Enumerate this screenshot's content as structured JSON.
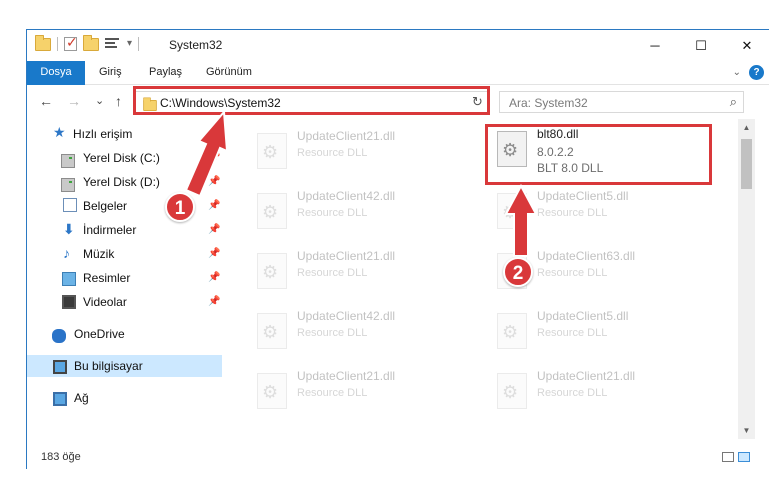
{
  "window": {
    "title": "System32",
    "minimize": "─",
    "maximize": "☐",
    "close": "✕"
  },
  "ribbon": {
    "tabs": [
      "Dosya",
      "Giriş",
      "Paylaş",
      "Görünüm"
    ],
    "active_tab": "Dosya",
    "help": "?",
    "collapse": "⌄"
  },
  "navigation": {
    "back": "←",
    "forward": "→",
    "recent": "⌄",
    "up": "↑",
    "address_path": "C:\\Windows\\System32",
    "address_dropdown": "⌄",
    "refresh": "↻",
    "search_placeholder": "Ara: System32",
    "search_icon": "⌕"
  },
  "sidebar": {
    "items": [
      {
        "label": "Hızlı erişim",
        "icon": "star-icon",
        "pinned": false
      },
      {
        "label": "Yerel Disk (C:)",
        "icon": "drive-icon",
        "pinned": true
      },
      {
        "label": "Yerel Disk (D:)",
        "icon": "drive-icon",
        "pinned": true
      },
      {
        "label": "Belgeler",
        "icon": "document-icon",
        "pinned": true
      },
      {
        "label": "İndirmeler",
        "icon": "download-icon",
        "pinned": true
      },
      {
        "label": "Müzik",
        "icon": "music-icon",
        "pinned": true
      },
      {
        "label": "Resimler",
        "icon": "pictures-icon",
        "pinned": true
      },
      {
        "label": "Videolar",
        "icon": "videos-icon",
        "pinned": true
      },
      {
        "label": "OneDrive",
        "icon": "onedrive-icon",
        "pinned": false
      },
      {
        "label": "Bu bilgisayar",
        "icon": "this-pc-icon",
        "pinned": false,
        "selected": true
      },
      {
        "label": "Ağ",
        "icon": "network-icon",
        "pinned": false
      }
    ],
    "pin_glyph": "📌"
  },
  "files": {
    "highlighted": {
      "name": "blt80.dll",
      "version": "8.0.2.2",
      "description": "BLT 8.0 DLL"
    },
    "left_column": [
      {
        "name": "UpdateClient21.dll",
        "type": "Resource DLL"
      },
      {
        "name": "UpdateClient42.dll",
        "type": "Resource DLL"
      },
      {
        "name": "UpdateClient21.dll",
        "type": "Resource DLL"
      },
      {
        "name": "UpdateClient42.dll",
        "type": "Resource DLL"
      },
      {
        "name": "UpdateClient21.dll",
        "type": "Resource DLL"
      }
    ],
    "right_column": [
      {
        "name": "UpdateClient5.dll",
        "type": "Resource DLL"
      },
      {
        "name": "UpdateClient63.dll",
        "type": "Resource DLL"
      },
      {
        "name": "UpdateClient5.dll",
        "type": "Resource DLL"
      },
      {
        "name": "UpdateClient21.dll",
        "type": "Resource DLL"
      }
    ]
  },
  "scrollbar": {
    "up": "▲",
    "down": "▼"
  },
  "status": {
    "item_count": "183 öğe"
  },
  "annotations": {
    "step1": "1",
    "step2": "2",
    "highlight_color": "#d9383a"
  }
}
